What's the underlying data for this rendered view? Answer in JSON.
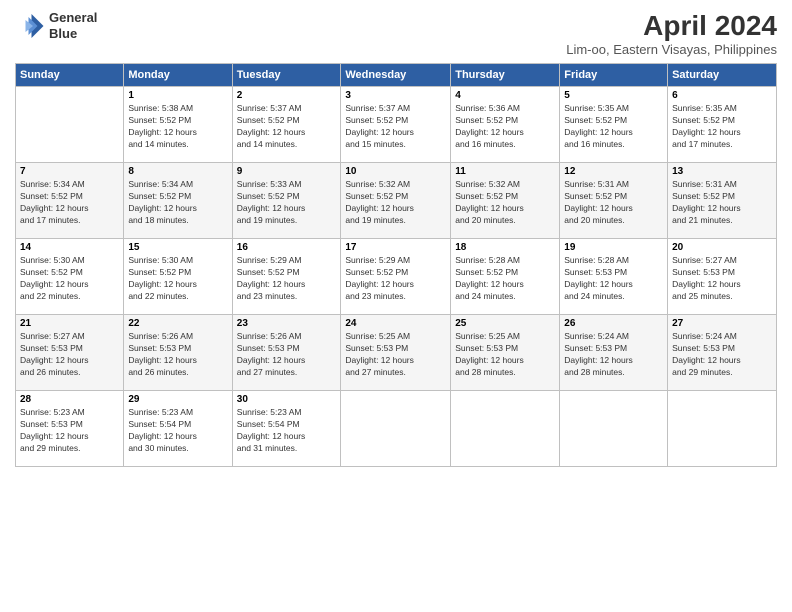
{
  "header": {
    "logo_line1": "General",
    "logo_line2": "Blue",
    "month": "April 2024",
    "location": "Lim-oo, Eastern Visayas, Philippines"
  },
  "weekdays": [
    "Sunday",
    "Monday",
    "Tuesday",
    "Wednesday",
    "Thursday",
    "Friday",
    "Saturday"
  ],
  "weeks": [
    [
      {
        "day": "",
        "info": ""
      },
      {
        "day": "1",
        "info": "Sunrise: 5:38 AM\nSunset: 5:52 PM\nDaylight: 12 hours\nand 14 minutes."
      },
      {
        "day": "2",
        "info": "Sunrise: 5:37 AM\nSunset: 5:52 PM\nDaylight: 12 hours\nand 14 minutes."
      },
      {
        "day": "3",
        "info": "Sunrise: 5:37 AM\nSunset: 5:52 PM\nDaylight: 12 hours\nand 15 minutes."
      },
      {
        "day": "4",
        "info": "Sunrise: 5:36 AM\nSunset: 5:52 PM\nDaylight: 12 hours\nand 16 minutes."
      },
      {
        "day": "5",
        "info": "Sunrise: 5:35 AM\nSunset: 5:52 PM\nDaylight: 12 hours\nand 16 minutes."
      },
      {
        "day": "6",
        "info": "Sunrise: 5:35 AM\nSunset: 5:52 PM\nDaylight: 12 hours\nand 17 minutes."
      }
    ],
    [
      {
        "day": "7",
        "info": "Sunrise: 5:34 AM\nSunset: 5:52 PM\nDaylight: 12 hours\nand 17 minutes."
      },
      {
        "day": "8",
        "info": "Sunrise: 5:34 AM\nSunset: 5:52 PM\nDaylight: 12 hours\nand 18 minutes."
      },
      {
        "day": "9",
        "info": "Sunrise: 5:33 AM\nSunset: 5:52 PM\nDaylight: 12 hours\nand 19 minutes."
      },
      {
        "day": "10",
        "info": "Sunrise: 5:32 AM\nSunset: 5:52 PM\nDaylight: 12 hours\nand 19 minutes."
      },
      {
        "day": "11",
        "info": "Sunrise: 5:32 AM\nSunset: 5:52 PM\nDaylight: 12 hours\nand 20 minutes."
      },
      {
        "day": "12",
        "info": "Sunrise: 5:31 AM\nSunset: 5:52 PM\nDaylight: 12 hours\nand 20 minutes."
      },
      {
        "day": "13",
        "info": "Sunrise: 5:31 AM\nSunset: 5:52 PM\nDaylight: 12 hours\nand 21 minutes."
      }
    ],
    [
      {
        "day": "14",
        "info": "Sunrise: 5:30 AM\nSunset: 5:52 PM\nDaylight: 12 hours\nand 22 minutes."
      },
      {
        "day": "15",
        "info": "Sunrise: 5:30 AM\nSunset: 5:52 PM\nDaylight: 12 hours\nand 22 minutes."
      },
      {
        "day": "16",
        "info": "Sunrise: 5:29 AM\nSunset: 5:52 PM\nDaylight: 12 hours\nand 23 minutes."
      },
      {
        "day": "17",
        "info": "Sunrise: 5:29 AM\nSunset: 5:52 PM\nDaylight: 12 hours\nand 23 minutes."
      },
      {
        "day": "18",
        "info": "Sunrise: 5:28 AM\nSunset: 5:52 PM\nDaylight: 12 hours\nand 24 minutes."
      },
      {
        "day": "19",
        "info": "Sunrise: 5:28 AM\nSunset: 5:53 PM\nDaylight: 12 hours\nand 24 minutes."
      },
      {
        "day": "20",
        "info": "Sunrise: 5:27 AM\nSunset: 5:53 PM\nDaylight: 12 hours\nand 25 minutes."
      }
    ],
    [
      {
        "day": "21",
        "info": "Sunrise: 5:27 AM\nSunset: 5:53 PM\nDaylight: 12 hours\nand 26 minutes."
      },
      {
        "day": "22",
        "info": "Sunrise: 5:26 AM\nSunset: 5:53 PM\nDaylight: 12 hours\nand 26 minutes."
      },
      {
        "day": "23",
        "info": "Sunrise: 5:26 AM\nSunset: 5:53 PM\nDaylight: 12 hours\nand 27 minutes."
      },
      {
        "day": "24",
        "info": "Sunrise: 5:25 AM\nSunset: 5:53 PM\nDaylight: 12 hours\nand 27 minutes."
      },
      {
        "day": "25",
        "info": "Sunrise: 5:25 AM\nSunset: 5:53 PM\nDaylight: 12 hours\nand 28 minutes."
      },
      {
        "day": "26",
        "info": "Sunrise: 5:24 AM\nSunset: 5:53 PM\nDaylight: 12 hours\nand 28 minutes."
      },
      {
        "day": "27",
        "info": "Sunrise: 5:24 AM\nSunset: 5:53 PM\nDaylight: 12 hours\nand 29 minutes."
      }
    ],
    [
      {
        "day": "28",
        "info": "Sunrise: 5:23 AM\nSunset: 5:53 PM\nDaylight: 12 hours\nand 29 minutes."
      },
      {
        "day": "29",
        "info": "Sunrise: 5:23 AM\nSunset: 5:54 PM\nDaylight: 12 hours\nand 30 minutes."
      },
      {
        "day": "30",
        "info": "Sunrise: 5:23 AM\nSunset: 5:54 PM\nDaylight: 12 hours\nand 31 minutes."
      },
      {
        "day": "",
        "info": ""
      },
      {
        "day": "",
        "info": ""
      },
      {
        "day": "",
        "info": ""
      },
      {
        "day": "",
        "info": ""
      }
    ]
  ]
}
